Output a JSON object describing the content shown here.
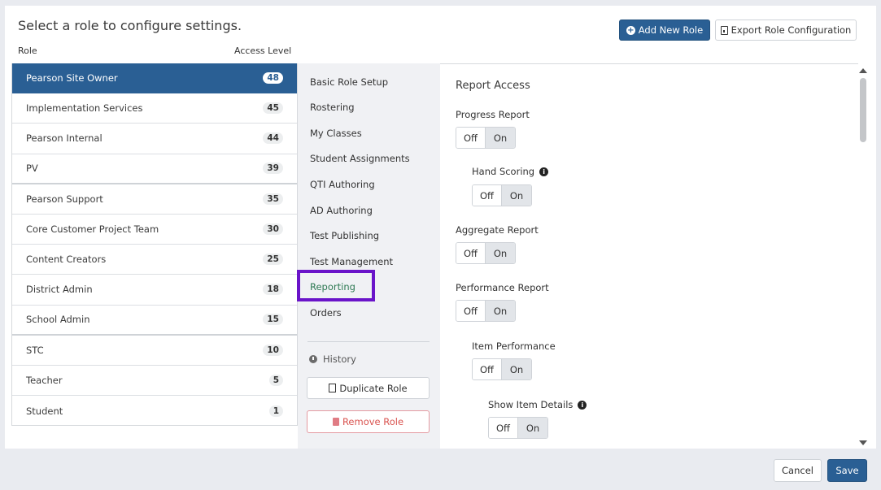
{
  "header": {
    "title": "Select a role to configure settings.",
    "add_role_label": "Add New Role",
    "export_label": "Export Role Configuration"
  },
  "columns": {
    "role": "Role",
    "access": "Access Level"
  },
  "roles": [
    {
      "name": "Pearson Site Owner",
      "level": "48"
    },
    {
      "name": "Implementation Services",
      "level": "45"
    },
    {
      "name": "Pearson Internal",
      "level": "44"
    },
    {
      "name": "PV",
      "level": "39"
    },
    {
      "name": "Pearson Support",
      "level": "35"
    },
    {
      "name": "Core Customer Project Team",
      "level": "30"
    },
    {
      "name": "Content Creators",
      "level": "25"
    },
    {
      "name": "District Admin",
      "level": "18"
    },
    {
      "name": "School Admin",
      "level": "15"
    },
    {
      "name": "STC",
      "level": "10"
    },
    {
      "name": "Teacher",
      "level": "5"
    },
    {
      "name": "Student",
      "level": "1"
    }
  ],
  "nav": {
    "items": [
      "Basic Role Setup",
      "Rostering",
      "My Classes",
      "Student Assignments",
      "QTI Authoring",
      "AD Authoring",
      "Test Publishing",
      "Test Management",
      "Reporting",
      "Orders"
    ],
    "history": "History",
    "duplicate": "Duplicate Role",
    "remove": "Remove Role"
  },
  "content": {
    "section_title": "Report Access",
    "off": "Off",
    "on": "On",
    "settings": [
      "Progress Report",
      "Hand Scoring",
      "Aggregate Report",
      "Performance Report",
      "Item Performance",
      "Show Item Details"
    ]
  },
  "footer": {
    "cancel": "Cancel",
    "save": "Save"
  },
  "colors": {
    "primary": "#2a5f94",
    "highlight": "#6a14c9",
    "selected_nav": "#2f7a54",
    "danger": "#d9534f"
  }
}
